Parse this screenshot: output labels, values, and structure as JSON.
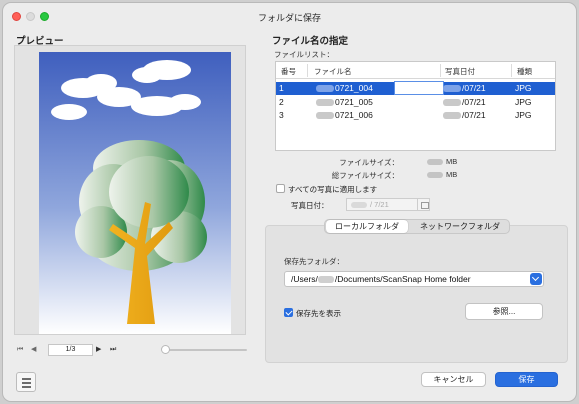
{
  "window": {
    "title": "フォルダに保存"
  },
  "preview": {
    "heading": "プレビュー",
    "page_indicator": "1/3",
    "nav": {
      "first": "⏮",
      "prev": "◀",
      "next": "▶",
      "last": "⏭"
    }
  },
  "file_name": {
    "heading": "ファイル名の指定",
    "list_label": "ファイルリスト：",
    "columns": [
      "番号",
      "ファイル名",
      "写真日付",
      "種類"
    ],
    "rows": [
      {
        "num": "1",
        "name": "0721_004",
        "date": "/07/21",
        "type": "JPG"
      },
      {
        "num": "2",
        "name": "0721_005",
        "date": "/07/21",
        "type": "JPG"
      },
      {
        "num": "3",
        "name": "0721_006",
        "date": "/07/21",
        "type": "JPG"
      }
    ],
    "selected_row": 0,
    "file_size_label": "ファイルサイズ：",
    "file_size_unit": "MB",
    "total_size_label": "総ファイルサイズ：",
    "total_size_unit": "MB",
    "apply_all_label": "すべての写真に適用します",
    "photo_date_label": "写真日付：",
    "photo_date_value": "/  7/21"
  },
  "tabs": {
    "local": "ローカルフォルダ",
    "network": "ネットワークフォルダ",
    "active": "local"
  },
  "destination": {
    "label": "保存先フォルダ：",
    "path_prefix": "/Users/",
    "path_suffix": "/Documents/ScanSnap Home folder",
    "show_label": "保存先を表示",
    "show_checked": true,
    "browse_label": "参照..."
  },
  "footer": {
    "cancel": "キャンセル",
    "save": "保存"
  },
  "colors": {
    "accent": "#2a6fe0",
    "selection": "#1f5fd1"
  }
}
